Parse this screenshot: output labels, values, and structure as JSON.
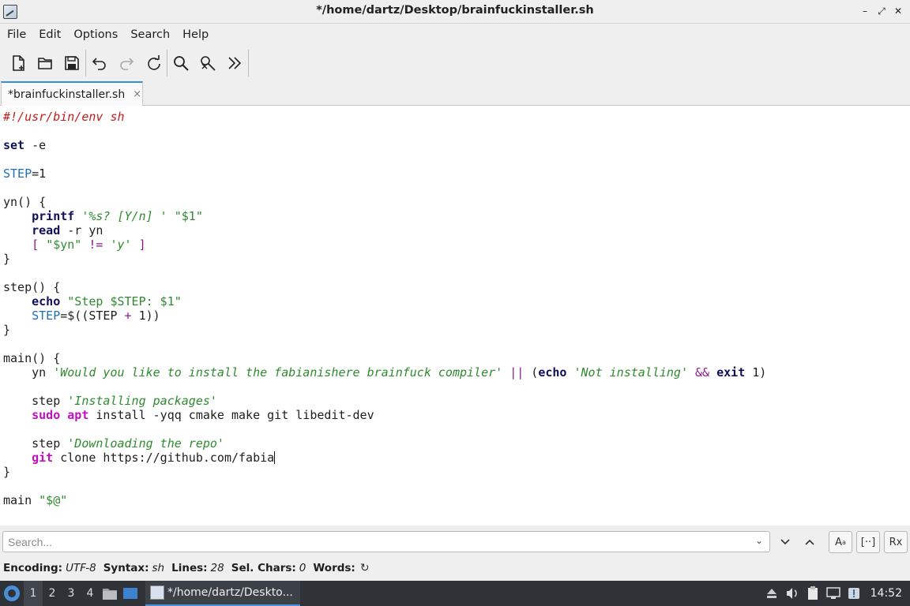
{
  "window": {
    "title": "*/home/dartz/Desktop/brainfuckinstaller.sh",
    "buttons": [
      "minimize",
      "maximize",
      "close"
    ]
  },
  "menu": [
    "File",
    "Edit",
    "Options",
    "Search",
    "Help"
  ],
  "toolbar": {
    "icons": [
      "new-file-icon",
      "open-folder-icon",
      "save-icon",
      "undo-icon",
      "redo-icon",
      "reload-icon",
      "find-icon",
      "replace-icon",
      "more-icon"
    ]
  },
  "tabs": [
    {
      "label": "*brainfuckinstaller.sh",
      "close": "×"
    }
  ],
  "code": {
    "lines": [
      [
        [
          "shebang",
          "#!/usr/bin/env sh"
        ]
      ],
      [],
      [
        [
          "kw",
          "set"
        ],
        [
          "plain",
          " -e"
        ]
      ],
      [],
      [
        [
          "var",
          "STEP"
        ],
        [
          "plain",
          "=1"
        ]
      ],
      [],
      [
        [
          "plain",
          "yn() {"
        ]
      ],
      [
        [
          "plain",
          "    "
        ],
        [
          "kw",
          "printf"
        ],
        [
          "plain",
          " "
        ],
        [
          "sq",
          "'%s? [Y/n] '"
        ],
        [
          "plain",
          " "
        ],
        [
          "str",
          "\"$1\""
        ]
      ],
      [
        [
          "plain",
          "    "
        ],
        [
          "kw",
          "read"
        ],
        [
          "plain",
          " -r yn"
        ]
      ],
      [
        [
          "plain",
          "    "
        ],
        [
          "op",
          "["
        ],
        [
          "plain",
          " "
        ],
        [
          "str",
          "\"$yn\""
        ],
        [
          "plain",
          " "
        ],
        [
          "op",
          "!="
        ],
        [
          "plain",
          " "
        ],
        [
          "sq",
          "'y'"
        ],
        [
          "plain",
          " "
        ],
        [
          "op",
          "]"
        ]
      ],
      [
        [
          "plain",
          "}"
        ]
      ],
      [],
      [
        [
          "plain",
          "step() {"
        ]
      ],
      [
        [
          "plain",
          "    "
        ],
        [
          "kw",
          "echo"
        ],
        [
          "plain",
          " "
        ],
        [
          "str",
          "\"Step $STEP: $1\""
        ]
      ],
      [
        [
          "plain",
          "    "
        ],
        [
          "var",
          "STEP"
        ],
        [
          "plain",
          "=$((STEP "
        ],
        [
          "op",
          "+"
        ],
        [
          "plain",
          " 1))"
        ]
      ],
      [
        [
          "plain",
          "}"
        ]
      ],
      [],
      [
        [
          "plain",
          "main() {"
        ]
      ],
      [
        [
          "plain",
          "    yn "
        ],
        [
          "sq",
          "'Would you like to install the fabianishere brainfuck compiler'"
        ],
        [
          "plain",
          " "
        ],
        [
          "op",
          "||"
        ],
        [
          "plain",
          " ("
        ],
        [
          "kw",
          "echo"
        ],
        [
          "plain",
          " "
        ],
        [
          "sq",
          "'Not installing'"
        ],
        [
          "plain",
          " "
        ],
        [
          "op",
          "&&"
        ],
        [
          "plain",
          " "
        ],
        [
          "kw",
          "exit"
        ],
        [
          "plain",
          " 1)"
        ]
      ],
      [],
      [
        [
          "plain",
          "    step "
        ],
        [
          "sq",
          "'Installing packages'"
        ]
      ],
      [
        [
          "plain",
          "    "
        ],
        [
          "sudo",
          "sudo"
        ],
        [
          "plain",
          " "
        ],
        [
          "sudo",
          "apt"
        ],
        [
          "plain",
          " install -yqq cmake make git libedit-dev"
        ]
      ],
      [],
      [
        [
          "plain",
          "    step "
        ],
        [
          "sq",
          "'Downloading the repo'"
        ]
      ],
      [
        [
          "plain",
          "    "
        ],
        [
          "sudo",
          "git"
        ],
        [
          "plain",
          " clone https://github.com/fabia"
        ],
        [
          "caret",
          ""
        ]
      ],
      [
        [
          "plain",
          "}"
        ]
      ],
      [],
      [
        [
          "plain",
          "main "
        ],
        [
          "str",
          "\"$@\""
        ]
      ]
    ]
  },
  "search": {
    "placeholder": "Search...",
    "buttons": [
      "chevron-down-icon",
      "chevron-up-icon",
      "match-case-icon",
      "whole-word-icon",
      "regex-icon"
    ],
    "labels": {
      "case": "A",
      "word": "[··]",
      "regex": "Rx"
    }
  },
  "status": {
    "encoding_label": "Encoding:",
    "encoding": "UTF-8",
    "syntax_label": "Syntax:",
    "syntax": "sh",
    "lines_label": "Lines:",
    "lines": "28",
    "selchars_label": "Sel. Chars:",
    "selchars": "0",
    "words_label": "Words:",
    "words": ""
  },
  "taskbar": {
    "workspaces": [
      "1",
      "2",
      "3",
      "4"
    ],
    "active_workspace": "1",
    "task_label": "*/home/dartz/Deskto...",
    "clock": "14:52"
  }
}
